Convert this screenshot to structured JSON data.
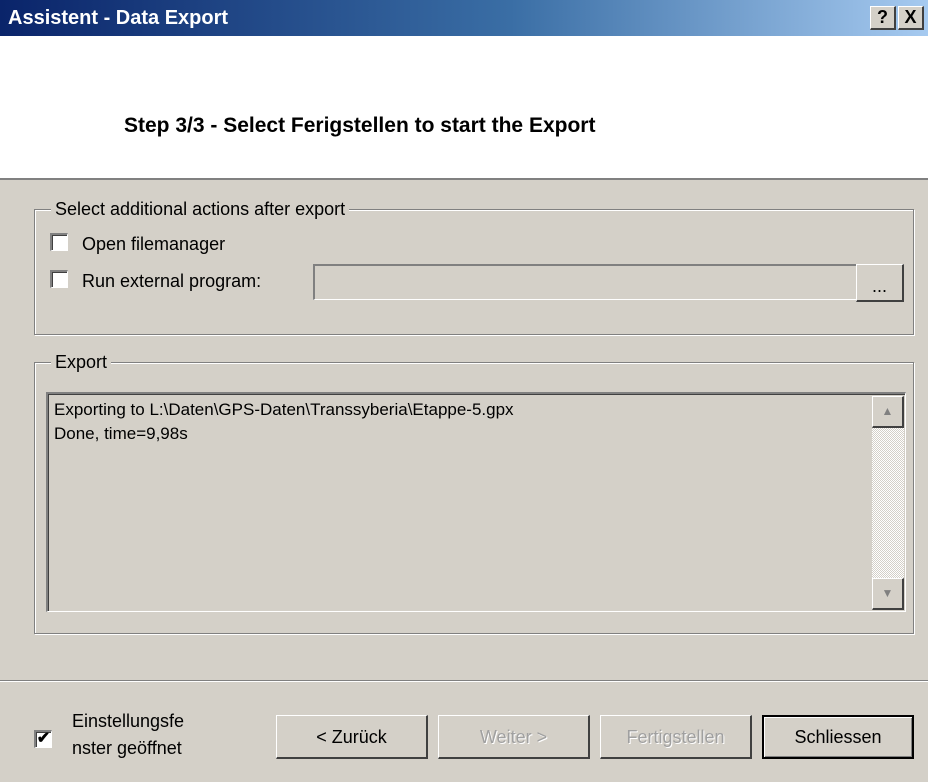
{
  "window": {
    "title": "Assistent - Data Export",
    "help_glyph": "?",
    "close_glyph": "X"
  },
  "header": {
    "step_title": "Step 3/3 - Select Ferigstellen to start the Export"
  },
  "actions_group": {
    "legend": "Select additional actions after export",
    "open_filemanager": {
      "label": "Open filemanager",
      "checked": false
    },
    "run_external": {
      "label": "Run external program:",
      "checked": false,
      "value": ""
    },
    "browse_label": "..."
  },
  "export_group": {
    "legend": "Export",
    "lines": [
      "Exporting to L:\\Daten\\GPS-Daten\\Transsyberia\\Etappe-5.gpx",
      "Done, time=9,98s"
    ],
    "scroll_up_icon": "▲",
    "scroll_down_icon": "▼"
  },
  "footer": {
    "settings_checkbox": {
      "label_line1": "Einstellungsfe",
      "label_line2": "nster geöffnet",
      "checked": true,
      "mark": "✔"
    },
    "back_label": "< Zurück",
    "next_label": "Weiter >",
    "finish_label": "Fertigstellen",
    "close_label": "Schliessen"
  },
  "colors": {
    "titlebar_start": "#0a246a",
    "titlebar_end": "#a6caf0",
    "dialog_face": "#d4d0c8",
    "disabled_text": "#a0a0a0"
  }
}
